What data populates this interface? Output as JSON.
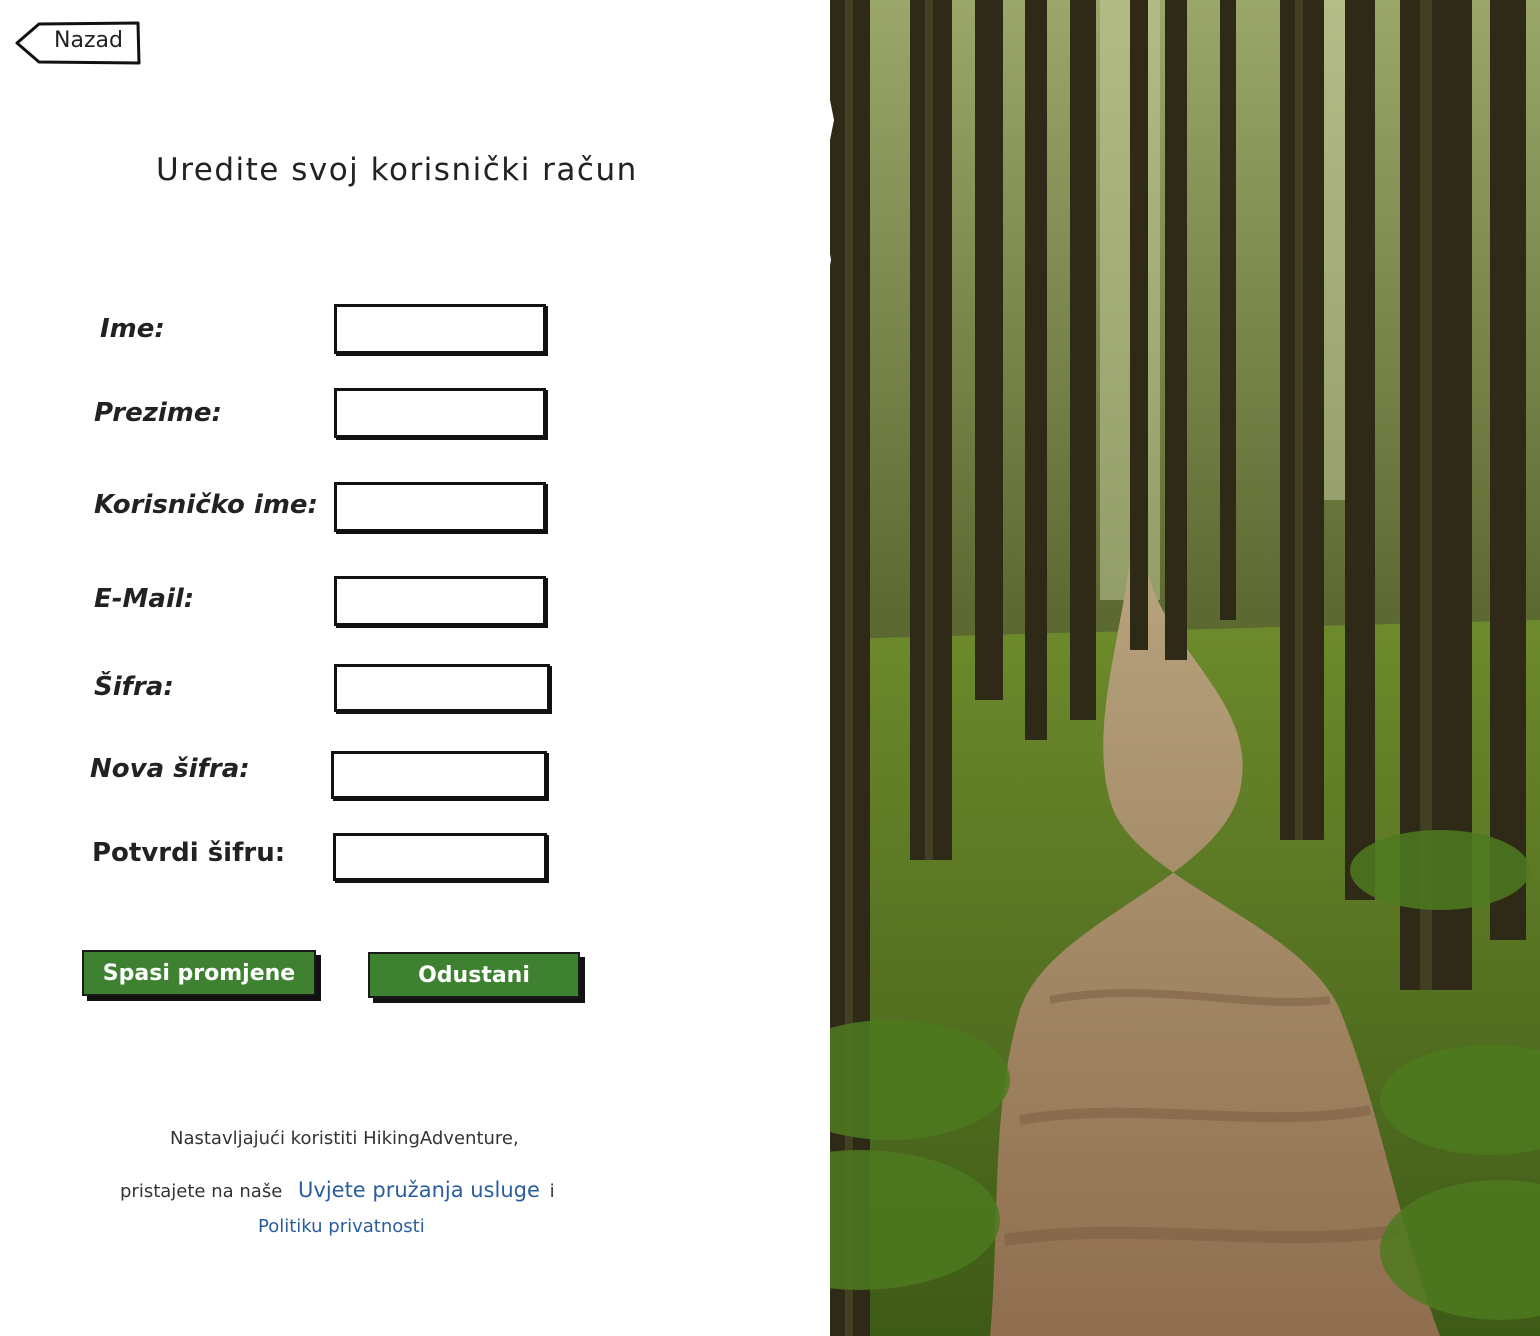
{
  "back_button": {
    "label": "Nazad"
  },
  "page": {
    "title": "Uredite svoj korisnički račun"
  },
  "form": {
    "fields": [
      {
        "label": "Ime:",
        "value": ""
      },
      {
        "label": "Prezime:",
        "value": ""
      },
      {
        "label": "Korisničko ime:",
        "value": ""
      },
      {
        "label": "E-Mail:",
        "value": ""
      },
      {
        "label": "Šifra:",
        "value": ""
      },
      {
        "label": "Nova šifra:",
        "value": ""
      },
      {
        "label": "Potvrdi šifru:",
        "value": ""
      }
    ],
    "save_label": "Spasi promjene",
    "cancel_label": "Odustani"
  },
  "footer": {
    "line1": "Nastavljajući koristiti HikingAdventure,",
    "line2_prefix": "pristajete na naše",
    "terms_link": "Uvjete pružanja usluge",
    "conjunction": "i",
    "privacy_link": "Politiku privatnosti"
  },
  "theme": {
    "button_green": "#3d8131",
    "link_blue": "#2a5d9e"
  }
}
